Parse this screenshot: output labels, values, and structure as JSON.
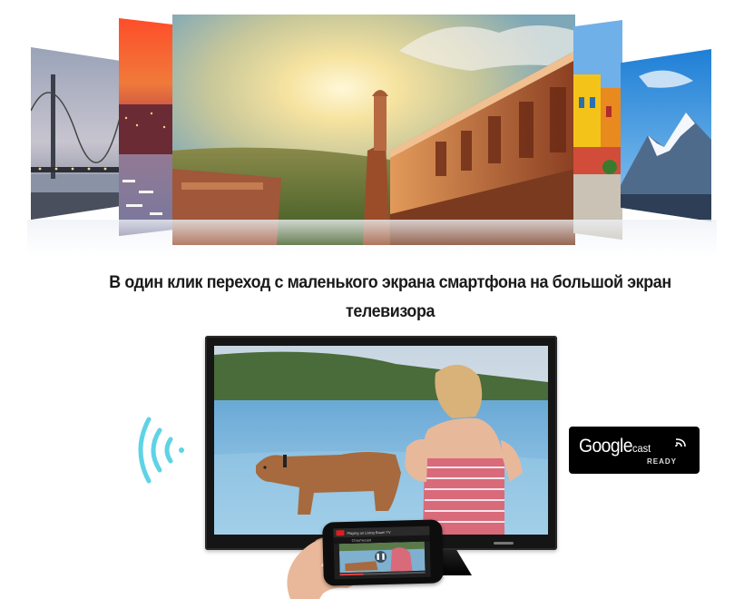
{
  "carousel": {
    "photos": [
      {
        "name": "bridge-photo",
        "subject": "bridge at dusk"
      },
      {
        "name": "harbor-photo",
        "subject": "sunset harbor"
      },
      {
        "name": "palace-photo",
        "subject": "sunlit palace balcony"
      },
      {
        "name": "houses-photo",
        "subject": "colorful houses"
      },
      {
        "name": "mountain-photo",
        "subject": "snowy mountain"
      }
    ]
  },
  "caption": {
    "line1": "В один клик переход с маленького экрана смартфона на большой  экран",
    "line2": "телевизора"
  },
  "tv": {
    "scene": "girl and dog at the sea"
  },
  "phone": {
    "app_title": "Playing on Living Room TV",
    "subtitle": "Chromecast",
    "progress": 0.28
  },
  "badge": {
    "brand_word": "Google",
    "product_word": "cast",
    "status_word": "READY"
  },
  "icons": {
    "wireless": "wireless-waves-icon",
    "cast": "cast-icon",
    "pause": "pause-icon",
    "youtube": "youtube-logo-icon"
  },
  "colors": {
    "caption_text": "#1a1a1a",
    "badge_background": "#000000",
    "waves": "#5fd3e6"
  }
}
